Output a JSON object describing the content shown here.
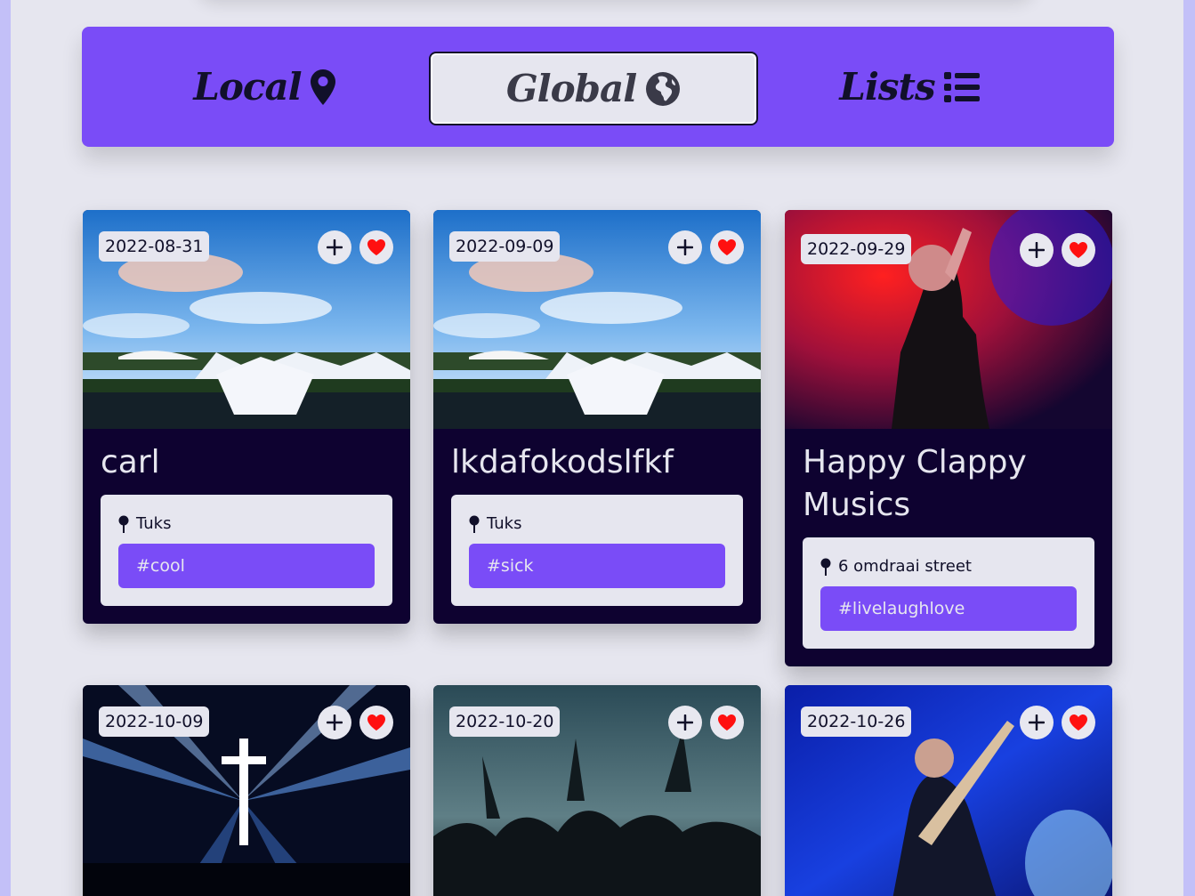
{
  "nav": {
    "local_label": "Local",
    "global_label": "Global",
    "lists_label": "Lists",
    "icons": [
      "map-marker-icon",
      "globe-africa-icon",
      "list-icon"
    ]
  },
  "events": [
    {
      "date": "2022-08-31",
      "title": "carl",
      "location": "Tuks",
      "tag": "#cool",
      "image": "tent-party-photo"
    },
    {
      "date": "2022-09-09",
      "title": "lkdafokodslfkf",
      "location": "Tuks",
      "tag": "#sick",
      "image": "tent-party-photo"
    },
    {
      "date": "2022-09-29",
      "title": "Happy Clappy Musics",
      "location": "6 omdraai street",
      "tag": "#livelaughlove",
      "image": "singer-red-light-photo"
    },
    {
      "date": "2022-10-09",
      "title": "",
      "location": "",
      "tag": "",
      "image": "concert-cross-lights-photo"
    },
    {
      "date": "2022-10-20",
      "title": "",
      "location": "",
      "tag": "",
      "image": "crowd-hands-photo"
    },
    {
      "date": "2022-10-26",
      "title": "",
      "location": "",
      "tag": "",
      "image": "guitarist-rain-photo"
    }
  ],
  "colors": {
    "accent": "#7a4cf7",
    "card_bg": "#0e0230",
    "page_bg": "#e6e6ef",
    "heart": "#ff1010"
  }
}
